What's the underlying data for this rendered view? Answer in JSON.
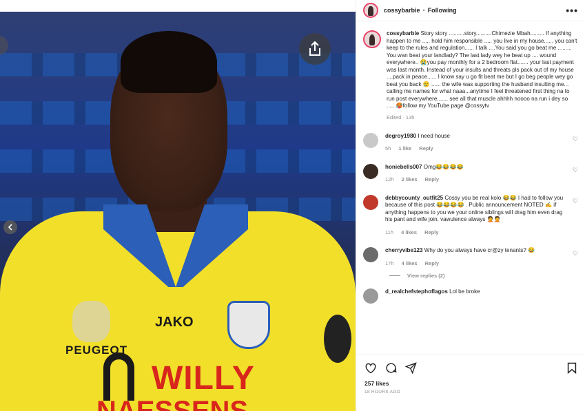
{
  "post": {
    "username": "cossybarbie",
    "follow_status": "Following",
    "more_label": "•••",
    "caption_username": "cossybarbie",
    "caption_text": "Story story ..........story..........Chimezie Mbah......... If anything happen to me ..... hold him responsible ..... you live in my house...... you can't keep to the rules and regulation...... I talk ....You said you go beat me ......... You wan beat your landlady? The last lady wey he beat up .... wound everywhere.. 😭you pay monthly for a 2 bedroom flat....... your last payment was last month. Instead of your insults and threats pls pack out of my house ....pack in peace...... I know say u go fit beat me but I go beg people wey go beat you back 😢 ...... the wife was supporting the husband insulting me... calling me names for what naaa...anytime I feel threatened first thing na to run post everywhere....... see all that muscle ahhhh noooo na run i dey so ......🥵follow my YouTube page @cossytv",
    "caption_meta": "Edited · 13h",
    "likes": "257 likes",
    "timestamp": "18 HOURS AGO"
  },
  "comments": [
    {
      "username": "degroy1980",
      "text": "I need house",
      "age": "5h",
      "likes": "1 like",
      "reply_label": "Reply",
      "avatar_color": "#c9c9c9"
    },
    {
      "username": "honiebells007",
      "text": "Omg😂😂😂😂",
      "age": "12h",
      "likes": "2 likes",
      "reply_label": "Reply",
      "avatar_color": "#3a2c25"
    },
    {
      "username": "debbycounty_outfit25",
      "text": "Cossy you be real kolo 😂😂 I had to follow you because of this post 😂😂😂😂 . Public announcement NOTED ✍️ if anything happens to you we your online siblings will drag him even drag his pant and wife join. vawulence always 🤦🤦",
      "age": "11h",
      "likes": "4 likes",
      "reply_label": "Reply",
      "avatar_color": "#c0392b"
    },
    {
      "username": "cherryvibe123",
      "text": "Why do you always have cr@zy tenants? 😂",
      "age": "17h",
      "likes": "4 likes",
      "reply_label": "Reply",
      "avatar_color": "#6b6b6b",
      "view_replies": "View replies (2)"
    },
    {
      "username": "d_realchefstephoflagos",
      "text": "Lol be broke",
      "avatar_color": "#999999"
    }
  ],
  "media": {
    "sponsor_brand": "JAKO",
    "sponsor_car": "PEUGEOT",
    "sponsor_main_1": "WILLY",
    "sponsor_main_2": "NAESSENS"
  },
  "icons": {
    "share": "share-icon",
    "prev": "chevron-left-icon",
    "like": "heart-icon",
    "comment": "comment-icon",
    "send": "send-icon",
    "save": "bookmark-icon"
  },
  "colors": {
    "accent_ring": "#e9446a",
    "jersey_yellow": "#f2df2a",
    "jersey_blue": "#2b5fb8",
    "sponsor_red": "#d8261c"
  }
}
